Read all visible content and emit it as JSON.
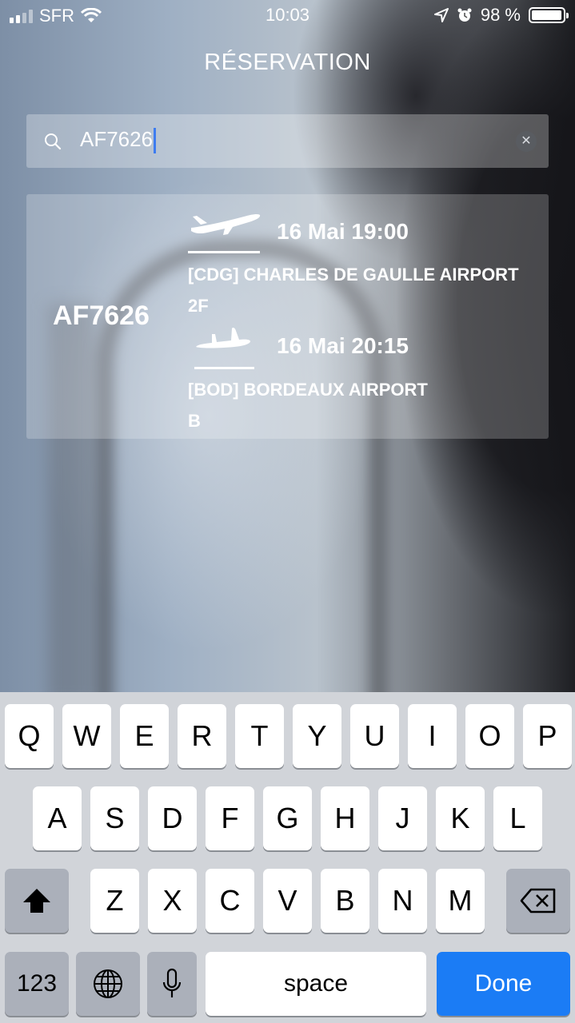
{
  "status_bar": {
    "carrier": "SFR",
    "time": "10:03",
    "battery": "98 %",
    "battery_level": 0.98
  },
  "header": {
    "title": "RÉSERVATION"
  },
  "search": {
    "value": "AF7626",
    "search_icon": "search-icon",
    "clear_icon": "clear-icon"
  },
  "result": {
    "flight": "AF7626",
    "departure": {
      "icon": "plane-takeoff-icon",
      "datetime": "16 Mai 19:00",
      "airport": "[CDG] CHARLES DE GAULLE AIRPORT",
      "terminal": "2F"
    },
    "arrival": {
      "icon": "plane-landing-icon",
      "datetime": "16 Mai 20:15",
      "airport": "[BOD] BORDEAUX AIRPORT",
      "terminal": "B"
    }
  },
  "keyboard": {
    "row1": [
      "Q",
      "W",
      "E",
      "R",
      "T",
      "Y",
      "U",
      "I",
      "O",
      "P"
    ],
    "row2": [
      "A",
      "S",
      "D",
      "F",
      "G",
      "H",
      "J",
      "K",
      "L"
    ],
    "row3": [
      "Z",
      "X",
      "C",
      "V",
      "B",
      "N",
      "M"
    ],
    "numbers": "123",
    "space": "space",
    "done": "Done",
    "accent_color": "#1b7cf5"
  }
}
